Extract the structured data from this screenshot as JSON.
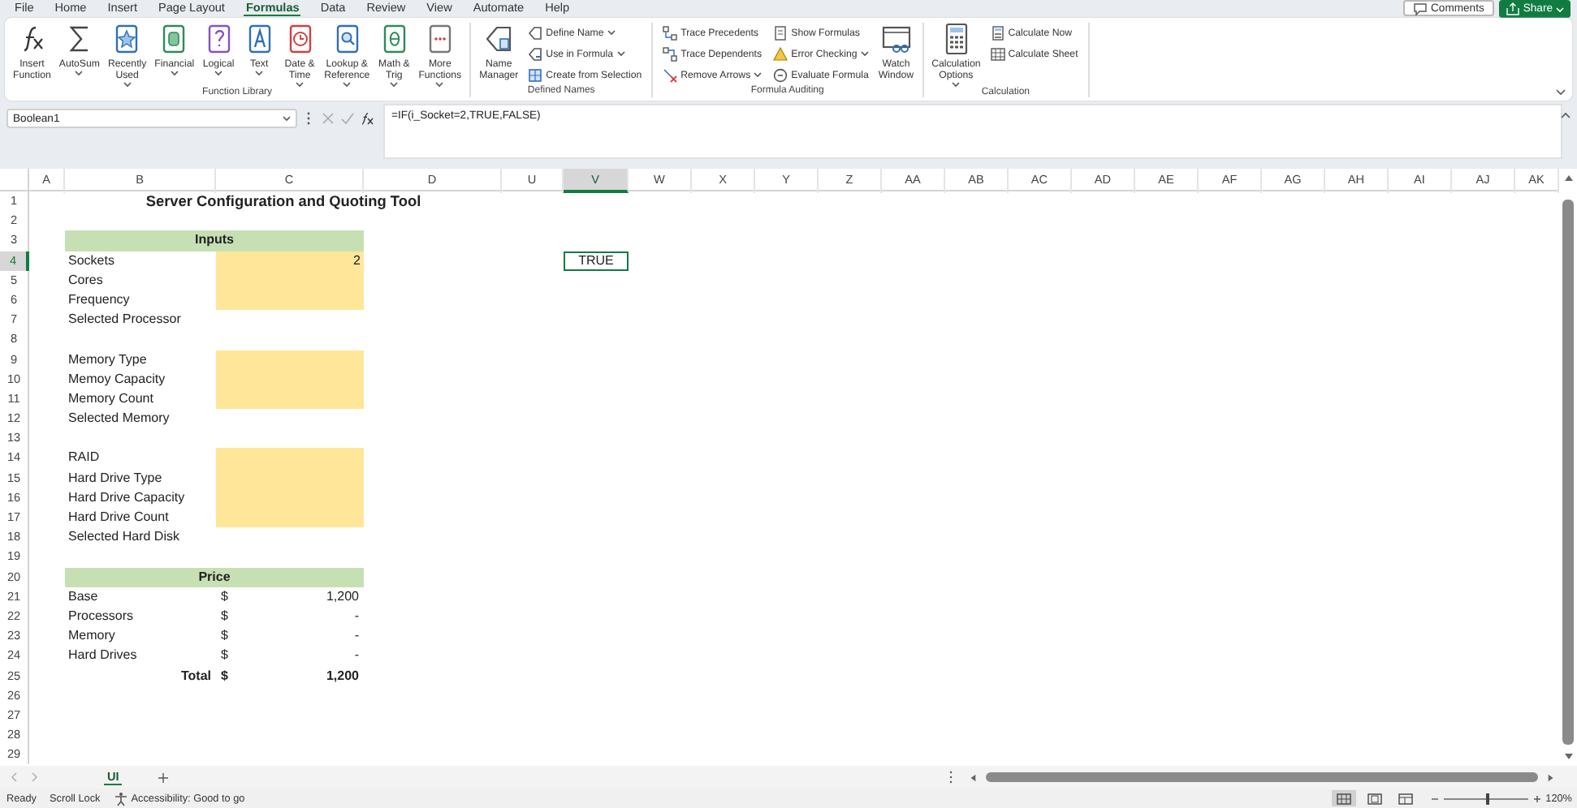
{
  "menu_tabs": [
    {
      "label": "File",
      "selected": false
    },
    {
      "label": "Home",
      "selected": false
    },
    {
      "label": "Insert",
      "selected": false
    },
    {
      "label": "Page Layout",
      "selected": false
    },
    {
      "label": "Formulas",
      "selected": true
    },
    {
      "label": "Data",
      "selected": false
    },
    {
      "label": "Review",
      "selected": false
    },
    {
      "label": "View",
      "selected": false
    },
    {
      "label": "Automate",
      "selected": false
    },
    {
      "label": "Help",
      "selected": false
    }
  ],
  "header_buttons": {
    "comments": "Comments",
    "share": "Share"
  },
  "ribbon": [
    {
      "label": "Function Library",
      "items": [
        {
          "kind": "large",
          "lines": [
            "Insert",
            "Function"
          ],
          "dropdown": false
        },
        {
          "kind": "large",
          "lines": [
            "AutoSum"
          ],
          "dropdown": true
        },
        {
          "kind": "large",
          "lines": [
            "Recently",
            "Used"
          ],
          "dropdown": true
        },
        {
          "kind": "large",
          "lines": [
            "Financial"
          ],
          "dropdown": true
        },
        {
          "kind": "large",
          "lines": [
            "Logical"
          ],
          "dropdown": true
        },
        {
          "kind": "large",
          "lines": [
            "Text"
          ],
          "dropdown": true
        },
        {
          "kind": "large",
          "lines": [
            "Date &",
            "Time"
          ],
          "dropdown": true
        },
        {
          "kind": "large",
          "lines": [
            "Lookup &",
            "Reference"
          ],
          "dropdown": true
        },
        {
          "kind": "large",
          "lines": [
            "Math &",
            "Trig"
          ],
          "dropdown": true
        },
        {
          "kind": "large",
          "lines": [
            "More",
            "Functions"
          ],
          "dropdown": true
        }
      ]
    },
    {
      "label": "Defined Names",
      "items": [
        {
          "kind": "large",
          "lines": [
            "Name",
            "Manager"
          ],
          "dropdown": false
        },
        {
          "kind": "stack",
          "buttons": [
            {
              "label": "Define Name",
              "dropdown": true
            },
            {
              "label": "Use in Formula",
              "dropdown": true
            },
            {
              "label": "Create from Selection",
              "dropdown": false
            }
          ]
        }
      ]
    },
    {
      "label": "Formula Auditing",
      "items": [
        {
          "kind": "stack",
          "buttons": [
            {
              "label": "Trace Precedents",
              "dropdown": false
            },
            {
              "label": "Trace Dependents",
              "dropdown": false
            },
            {
              "label": "Remove Arrows",
              "dropdown": true
            }
          ]
        },
        {
          "kind": "stack",
          "buttons": [
            {
              "label": "Show Formulas",
              "dropdown": false
            },
            {
              "label": "Error Checking",
              "dropdown": true
            },
            {
              "label": "Evaluate Formula",
              "dropdown": false
            }
          ]
        },
        {
          "kind": "large",
          "lines": [
            "Watch",
            "Window"
          ],
          "dropdown": false
        }
      ]
    },
    {
      "label": "Calculation",
      "items": [
        {
          "kind": "large",
          "lines": [
            "Calculation",
            "Options"
          ],
          "dropdown": true
        },
        {
          "kind": "stack",
          "buttons": [
            {
              "label": "Calculate Now",
              "dropdown": false
            },
            {
              "label": "Calculate Sheet",
              "dropdown": false
            }
          ]
        }
      ]
    }
  ],
  "formula_bar": {
    "name_box": "Boolean1",
    "formula": "=IF(i_Socket=2,TRUE,FALSE)"
  },
  "sheet": {
    "columns": [
      {
        "label": "A",
        "selected": false
      },
      {
        "label": "B",
        "selected": false
      },
      {
        "label": "C",
        "selected": false
      },
      {
        "label": "D",
        "selected": false
      },
      {
        "label": "U",
        "selected": false
      },
      {
        "label": "V",
        "selected": true
      },
      {
        "label": "W",
        "selected": false
      },
      {
        "label": "X",
        "selected": false
      },
      {
        "label": "Y",
        "selected": false
      },
      {
        "label": "Z",
        "selected": false
      },
      {
        "label": "AA",
        "selected": false
      },
      {
        "label": "AB",
        "selected": false
      },
      {
        "label": "AC",
        "selected": false
      },
      {
        "label": "AD",
        "selected": false
      },
      {
        "label": "AE",
        "selected": false
      },
      {
        "label": "AF",
        "selected": false
      },
      {
        "label": "AG",
        "selected": false
      },
      {
        "label": "AH",
        "selected": false
      },
      {
        "label": "AI",
        "selected": false
      },
      {
        "label": "AJ",
        "selected": false
      },
      {
        "label": "AK",
        "selected": false
      }
    ],
    "rows": [
      {
        "number": "1",
        "selected": false,
        "kind": "title",
        "text": "Server Configuration and Quoting Tool"
      },
      {
        "number": "2",
        "selected": false
      },
      {
        "number": "3",
        "selected": false,
        "kind": "section",
        "text": "Inputs"
      },
      {
        "number": "4",
        "selected": true,
        "kind": "field",
        "label": "Sockets",
        "value": "2",
        "input": true
      },
      {
        "number": "5",
        "selected": false,
        "kind": "field",
        "label": "Cores",
        "input": true
      },
      {
        "number": "6",
        "selected": false,
        "kind": "field",
        "label": "Frequency",
        "input": true
      },
      {
        "number": "7",
        "selected": false,
        "kind": "field",
        "label": "Selected Processor",
        "input": false
      },
      {
        "number": "8",
        "selected": false
      },
      {
        "number": "9",
        "selected": false,
        "kind": "field",
        "label": "Memory Type",
        "input": true
      },
      {
        "number": "10",
        "selected": false,
        "kind": "field",
        "label": "Memoy Capacity",
        "input": true
      },
      {
        "number": "11",
        "selected": false,
        "kind": "field",
        "label": "Memory Count",
        "input": true
      },
      {
        "number": "12",
        "selected": false,
        "kind": "field",
        "label": "Selected Memory",
        "input": false
      },
      {
        "number": "13",
        "selected": false
      },
      {
        "number": "14",
        "selected": false,
        "kind": "field",
        "label": "RAID",
        "input": true
      },
      {
        "number": "15",
        "selected": false,
        "kind": "field",
        "label": "Hard Drive Type",
        "input": true
      },
      {
        "number": "16",
        "selected": false,
        "kind": "field",
        "label": "Hard Drive Capacity",
        "input": true
      },
      {
        "number": "17",
        "selected": false,
        "kind": "field",
        "label": "Hard Drive Count",
        "input": true
      },
      {
        "number": "18",
        "selected": false,
        "kind": "field",
        "label": "Selected Hard Disk",
        "input": false
      },
      {
        "number": "19",
        "selected": false
      },
      {
        "number": "20",
        "selected": false,
        "kind": "section",
        "text": "Price"
      },
      {
        "number": "21",
        "selected": false,
        "kind": "price",
        "label": "Base",
        "currency": "$",
        "value": "1,200"
      },
      {
        "number": "22",
        "selected": false,
        "kind": "price",
        "label": "Processors",
        "currency": "$",
        "value": "-"
      },
      {
        "number": "23",
        "selected": false,
        "kind": "price",
        "label": "Memory",
        "currency": "$",
        "value": "-"
      },
      {
        "number": "24",
        "selected": false,
        "kind": "price",
        "label": "Hard Drives",
        "currency": "$",
        "value": "-"
      },
      {
        "number": "25",
        "selected": false,
        "kind": "total",
        "label": "Total",
        "currency": "$",
        "value": "1,200"
      },
      {
        "number": "26",
        "selected": false
      },
      {
        "number": "27",
        "selected": false
      },
      {
        "number": "28",
        "selected": false
      },
      {
        "number": "29",
        "selected": false
      }
    ],
    "active_cell": {
      "value": "TRUE"
    }
  },
  "sheet_tabs": [
    {
      "label": "UI",
      "selected": true
    }
  ],
  "status_bar": {
    "ready": "Ready",
    "scroll_lock": "Scroll Lock",
    "accessibility": "Accessibility: Good to go",
    "views": [
      {
        "selected": true
      },
      {
        "selected": false
      },
      {
        "selected": false
      }
    ],
    "zoom": {
      "level": 0.52,
      "reading": "120%"
    }
  }
}
